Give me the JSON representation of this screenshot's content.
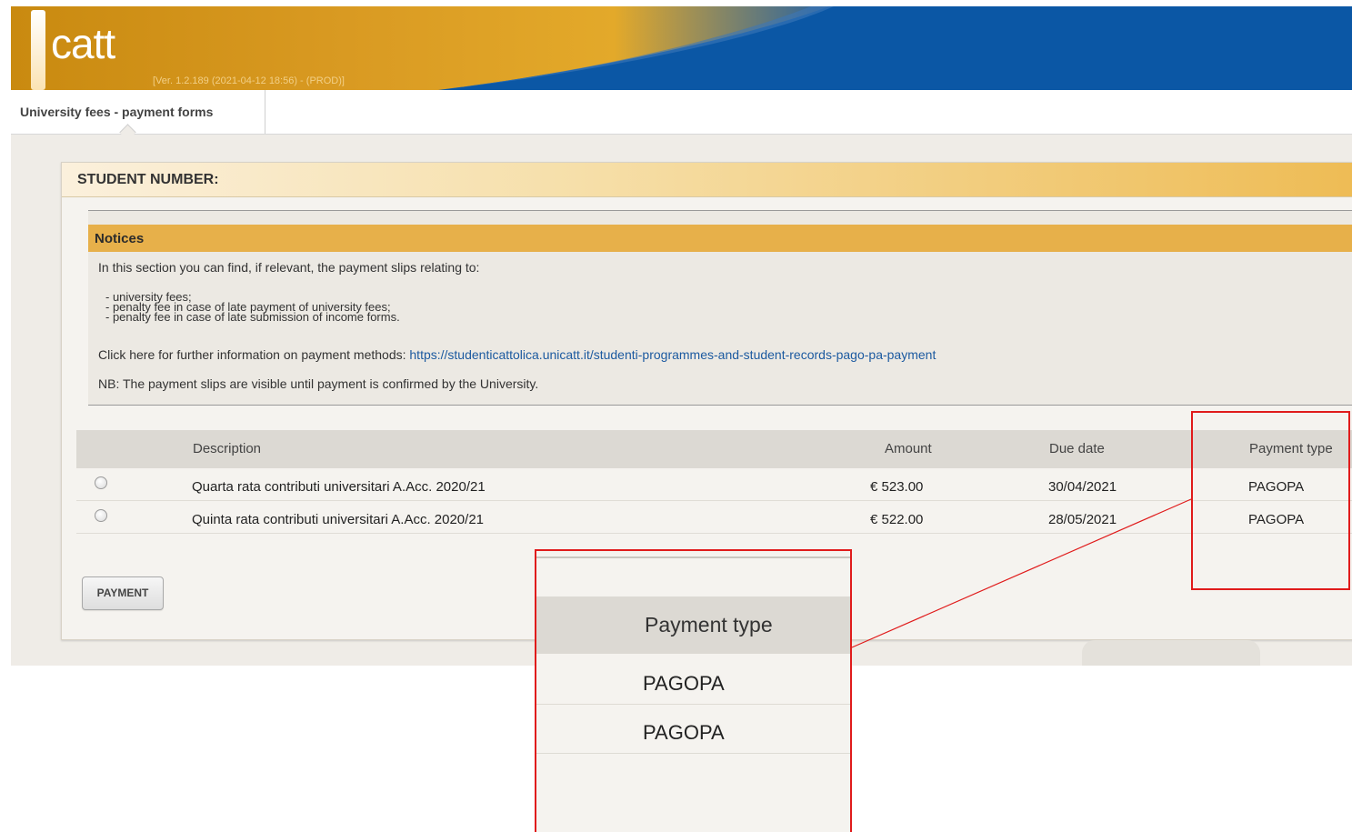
{
  "header": {
    "logo_text": "catt",
    "version": "[Ver. 1.2.189 (2021-04-12 18:56) - (PROD)]"
  },
  "tabs": [
    {
      "label": "University fees - payment forms",
      "active": true
    }
  ],
  "panel": {
    "title": "STUDENT NUMBER:"
  },
  "notices": {
    "title": "Notices",
    "intro": "In this section you can find, if relevant, the payment slips relating to:",
    "items": [
      "-  university fees;",
      "-  penalty fee in case of late payment of university fees;",
      "-  penalty fee in case of late submission of income forms."
    ],
    "info_prefix": "Click here for further information on payment methods: ",
    "info_link": "https://studenticattolica.unicatt.it/studenti-programmes-and-student-records-pago-pa-payment",
    "nb": "NB: The payment slips are visible until payment is confirmed by the University."
  },
  "table": {
    "headers": {
      "description": "Description",
      "amount": "Amount",
      "due_date": "Due date",
      "payment_type": "Payment type"
    },
    "rows": [
      {
        "description": "Quarta rata contributi universitari A.Acc. 2020/21",
        "amount": "€ 523.00",
        "due_date": "30/04/2021",
        "payment_type": "PAGOPA"
      },
      {
        "description": "Quinta rata contributi universitari A.Acc. 2020/21",
        "amount": "€ 522.00",
        "due_date": "28/05/2021",
        "payment_type": "PAGOPA"
      }
    ]
  },
  "payment_button": "PAYMENT",
  "zoom_callout": {
    "header": "Payment type",
    "values": [
      "PAGOPA",
      "PAGOPA"
    ],
    "highlight_color": "#e01b1b"
  }
}
